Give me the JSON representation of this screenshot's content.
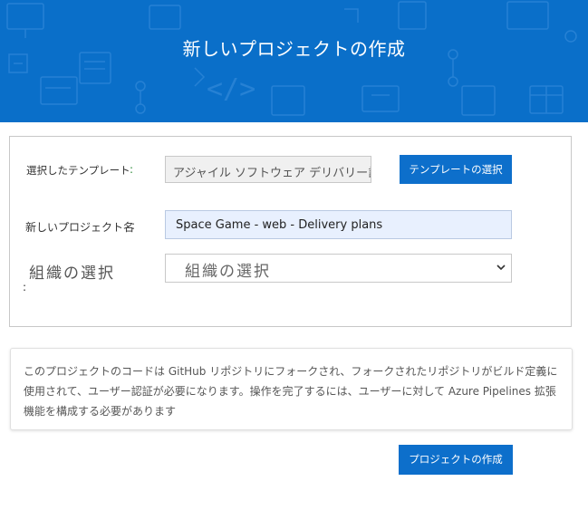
{
  "header": {
    "title": "新しいプロジェクトの作成"
  },
  "form": {
    "template_label": "選択したテンプレート",
    "template_colon": ":",
    "template_value": "アジャイル ソフトウェア デリバリー計p",
    "template_button": "テンプレートの選択",
    "project_name_label": "新しいプロジェクト名",
    "project_name_colon": ":",
    "project_name_value": "Space Game - web - Delivery plans",
    "org_label": "組織の選択",
    "org_colon": ":",
    "org_select_value": "組織の選択"
  },
  "notice": {
    "text": "このプロジェクトのコードは GitHub リポジトリにフォークされ、フォークされたリポジトリがビルド定義に使用されて、ユーザー認証が必要になります。操作を完了するには、ユーザーに対して Azure Pipelines 拡張機能を構成する必要があります"
  },
  "actions": {
    "create_button": "プロジェクトの作成"
  },
  "colors": {
    "header_bg": "#0a6fc9",
    "button_bg": "#0d6fcb",
    "colon_green": "#2e8b3a"
  }
}
